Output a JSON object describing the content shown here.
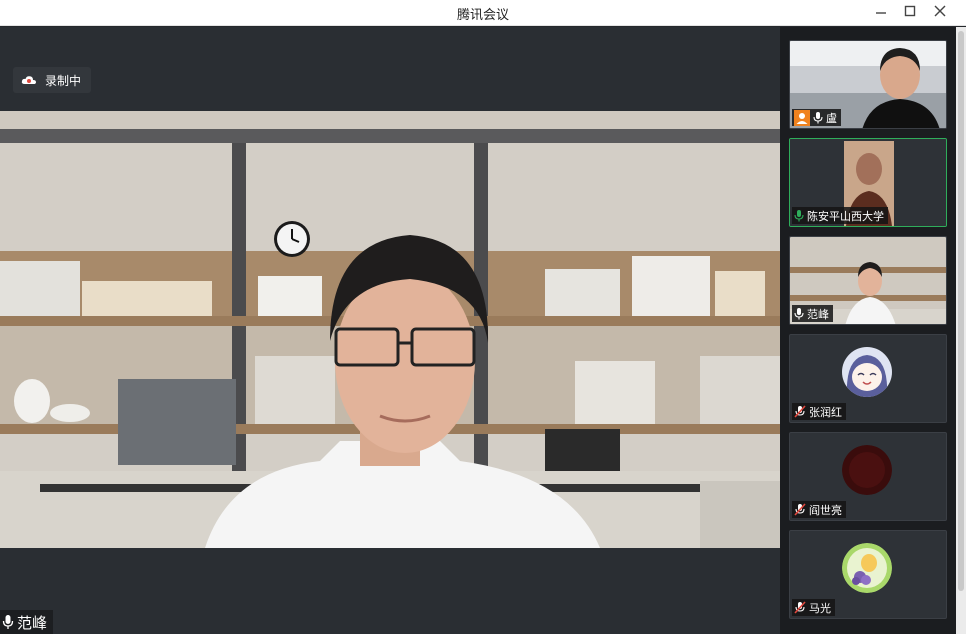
{
  "window": {
    "title": "腾讯会议"
  },
  "recording": {
    "label": "录制中"
  },
  "main_speaker": {
    "name": "范峰"
  },
  "participants": [
    {
      "name": "盧",
      "mic": "on"
    },
    {
      "name": "陈安平山西大学",
      "mic": "on-active"
    },
    {
      "name": "范峰",
      "mic": "on"
    },
    {
      "name": "张润红",
      "mic": "muted"
    },
    {
      "name": "阎世亮",
      "mic": "muted"
    },
    {
      "name": "马光",
      "mic": "muted"
    }
  ],
  "colors": {
    "active_border": "#2fae5b",
    "muted_icon": "#e0483e",
    "host_badge": "#f0821e"
  }
}
